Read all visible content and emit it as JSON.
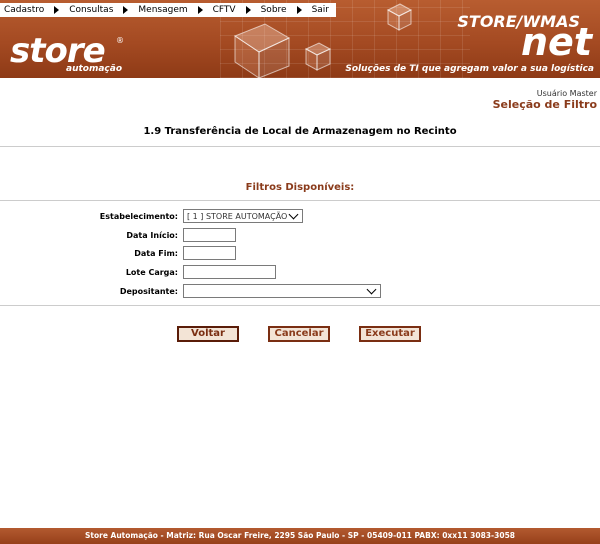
{
  "menu": {
    "items": [
      {
        "label": "Cadastro"
      },
      {
        "label": "Consultas"
      },
      {
        "label": "Mensagem"
      },
      {
        "label": "CFTV"
      },
      {
        "label": "Sobre"
      },
      {
        "label": "Sair"
      }
    ]
  },
  "header": {
    "logo_text": "store",
    "logo_sub": "automação",
    "registered_mark": "®",
    "brand_top": "STORE/WMAS",
    "brand_bottom": "net",
    "tagline": "Soluções de TI que agregam valor a sua logística"
  },
  "user": {
    "name": "Usuário Master",
    "page": "Seleção de Filtro"
  },
  "page_title": "1.9 Transferência de Local de Armazenagem no Recinto",
  "filters": {
    "title": "Filtros Disponíveis:",
    "estabelecimento_label": "Estabelecimento:",
    "estabelecimento_value": "[ 1 ] STORE AUTOMAÇÃO",
    "data_inicio_label": "Data Início:",
    "data_inicio_value": "",
    "data_fim_label": "Data Fim:",
    "data_fim_value": "",
    "lote_carga_label": "Lote Carga:",
    "lote_carga_value": "",
    "depositante_label": "Depositante:",
    "depositante_value": ""
  },
  "buttons": {
    "voltar": "Voltar",
    "cancelar": "Cancelar",
    "executar": "Executar"
  },
  "footer": {
    "text": "Store Automação - Matriz: Rua Oscar Freire, 2295 São Paulo - SP - 05409-011 PABX: 0xx11 3083-3058"
  }
}
